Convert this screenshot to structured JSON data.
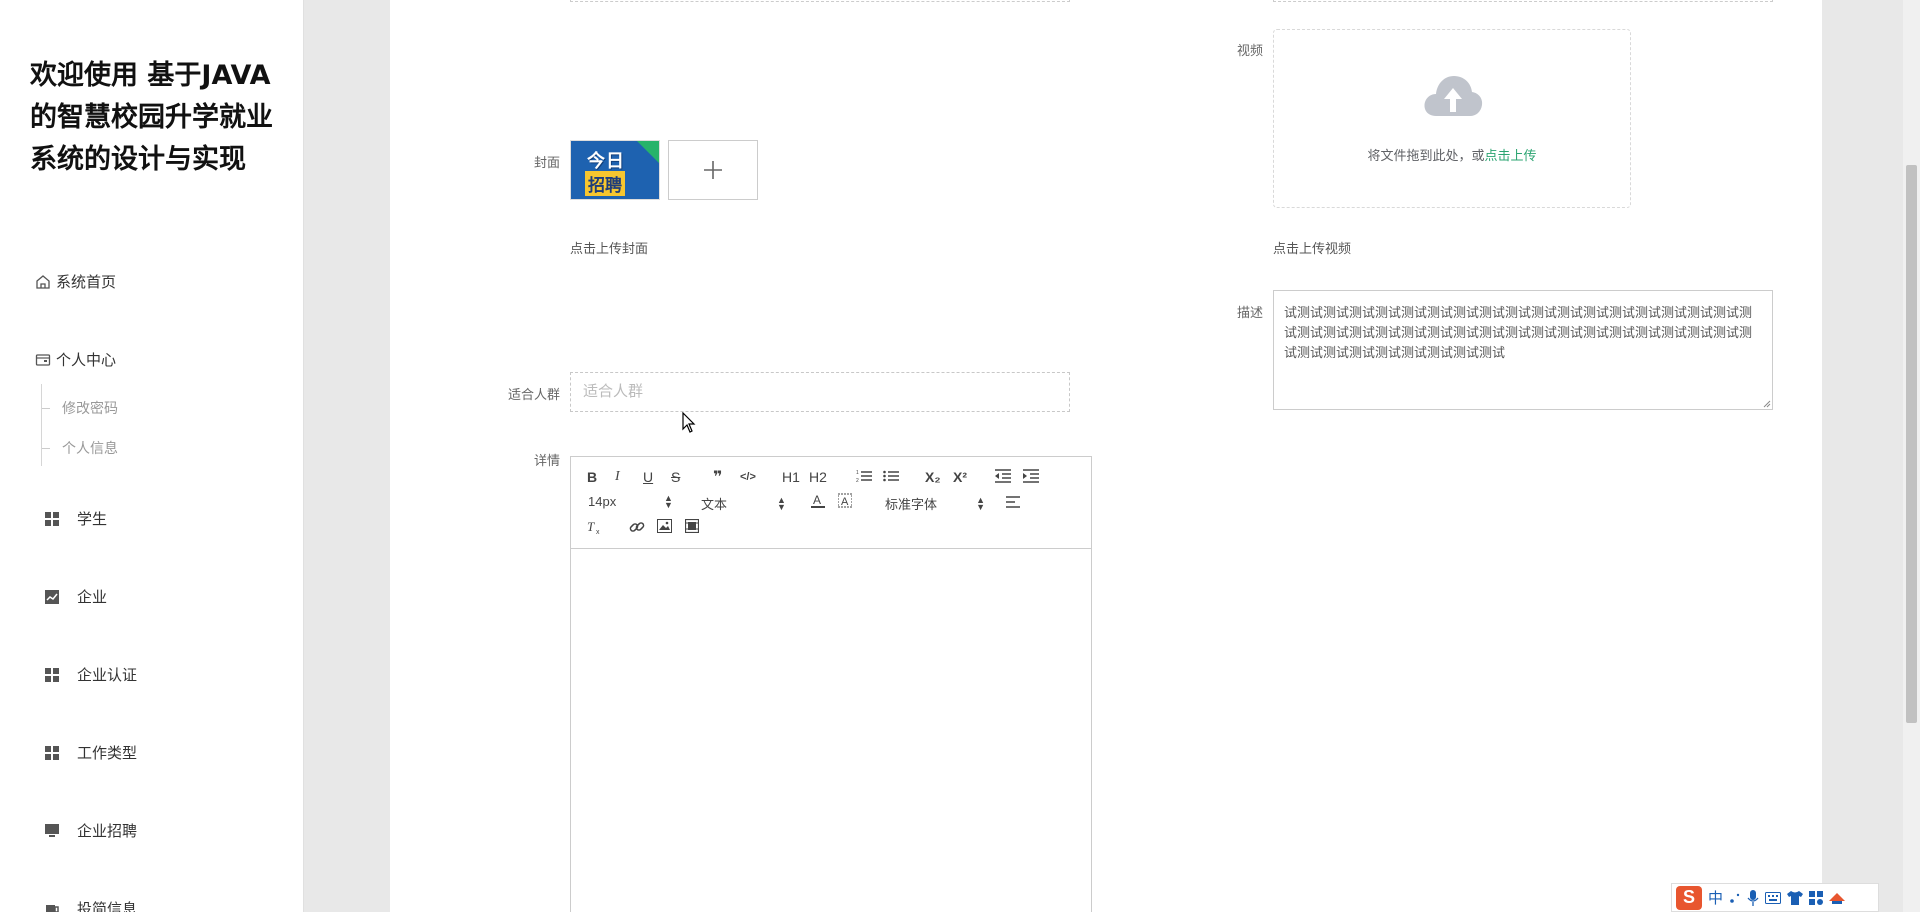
{
  "sidebar": {
    "title": "欢迎使用 基于JAVA的智慧校园升学就业系统的设计与实现",
    "items": [
      {
        "label": "系统首页",
        "icon": "home-icon"
      },
      {
        "label": "个人中心",
        "icon": "wallet-icon"
      },
      {
        "label": "学生",
        "icon": "grid-icon"
      },
      {
        "label": "企业",
        "icon": "chart-icon"
      },
      {
        "label": "企业认证",
        "icon": "grid-icon"
      },
      {
        "label": "工作类型",
        "icon": "grid-icon"
      },
      {
        "label": "企业招聘",
        "icon": "monitor-icon"
      },
      {
        "label": "投简信息",
        "icon": "cup-icon"
      }
    ],
    "sub_items": [
      "修改密码",
      "个人信息"
    ]
  },
  "form": {
    "cover_label": "封面",
    "cover_hint": "点击上传封面",
    "cover_image_text_top": "今日",
    "cover_image_text_bottom": "招聘",
    "video_label": "视频",
    "video_upload_text": "将文件拖到此处，或",
    "video_upload_link": "点击上传",
    "video_hint": "点击上传视频",
    "desc_label": "描述",
    "desc_value": "试测试测试测试测试测试测试测试测试测试测试测试测试测试测试测试测试测试测试测试测试测试测试测试测试测试测试测试测试测试测试测试测试测试测试测试测试测试测试测试测试测试测试测试测试",
    "audience_label": "适合人群",
    "audience_placeholder": "适合人群",
    "detail_label": "详情"
  },
  "editor": {
    "font_size": "14px",
    "header_select": "文本",
    "font_family": "标准字体",
    "buttons": [
      "B",
      "I",
      "U",
      "S",
      "❞",
      "</>",
      "H1",
      "H2",
      "ordered-list",
      "bullet-list",
      "X₂",
      "X²",
      "outdent",
      "indent",
      "text-color",
      "background-color",
      "align",
      "clean",
      "link",
      "image",
      "video"
    ]
  },
  "ime": {
    "lang": "中"
  },
  "colors": {
    "accent": "#2ba471",
    "sidebar_bg": "#ffffff",
    "page_bg": "#e8e8e8"
  }
}
